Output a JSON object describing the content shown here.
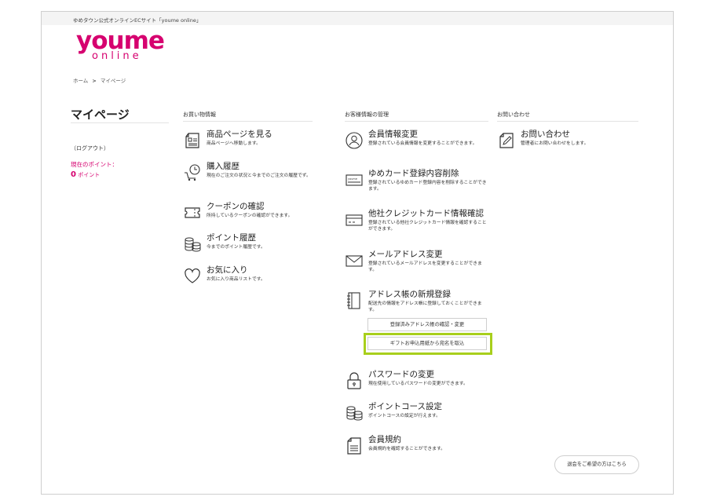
{
  "topbar": {
    "text": "ゆめタウン公式オンラインECサイト「youme online」"
  },
  "logo": {
    "main": "youme",
    "sub": "online"
  },
  "breadcrumb": {
    "home": "ホーム",
    "sep": ">",
    "current": "マイページ"
  },
  "sidebar": {
    "title": "マイページ",
    "logout": "（ログアウト）",
    "points_label": "現在のポイント：",
    "points_value": "0",
    "points_unit": "ポイント"
  },
  "columns": {
    "shopping": {
      "heading": "お買い物情報",
      "items": [
        {
          "title": "商品ページを見る",
          "desc": "商品ページへ移動します。"
        },
        {
          "title": "購入履歴",
          "desc": "現在のご注文の状況と今までのご注文の履歴でず。"
        },
        {
          "title": "クーポンの確認",
          "desc": "所持しているクーポンの確認ができます。"
        },
        {
          "title": "ポイント履歴",
          "desc": "今までのポイント履歴です。"
        },
        {
          "title": "お気に入り",
          "desc": "お気に入り商品リストです。"
        }
      ]
    },
    "customer": {
      "heading": "お客様情報の管理",
      "items": [
        {
          "title": "会員情報変更",
          "desc": "登録されている会員情報を変更することができます。"
        },
        {
          "title": "ゆめカード登録内容削除",
          "desc": "登録されているゆめカード登録内容を削除することができます。"
        },
        {
          "title": "他社クレジットカード情報確認",
          "desc": "登録されている他社クレジットカード情報を確認することができます。"
        },
        {
          "title": "メールアドレス変更",
          "desc": "登録されているメールアドレスを変更することができます。"
        },
        {
          "title": "アドレス帳の新規登録",
          "desc": "配送先の情報をアドレス帳に登録しておくことができます。"
        },
        {
          "title": "パスワードの変更",
          "desc": "現在使用しているパスワードの変更ができます。"
        },
        {
          "title": "ポイントコース設定",
          "desc": "ポイントコースの設定が行えます。"
        },
        {
          "title": "会員規約",
          "desc": "会員規約を確認することができます。"
        }
      ],
      "address_buttons": {
        "view": "登録済みアドレス帳の確認・変更",
        "gift": "ギフトお申込用紙から宛名を取込"
      },
      "card_icon_text": "youme"
    },
    "contact": {
      "heading": "お問い合わせ",
      "items": [
        {
          "title": "お問い合わせ",
          "desc": "管理者にお問い合わせをします。"
        }
      ]
    }
  },
  "withdraw_button": "退会をご希望の方はこちら",
  "colors": {
    "brand": "#d6006f",
    "highlight": "#a8cf1c"
  }
}
